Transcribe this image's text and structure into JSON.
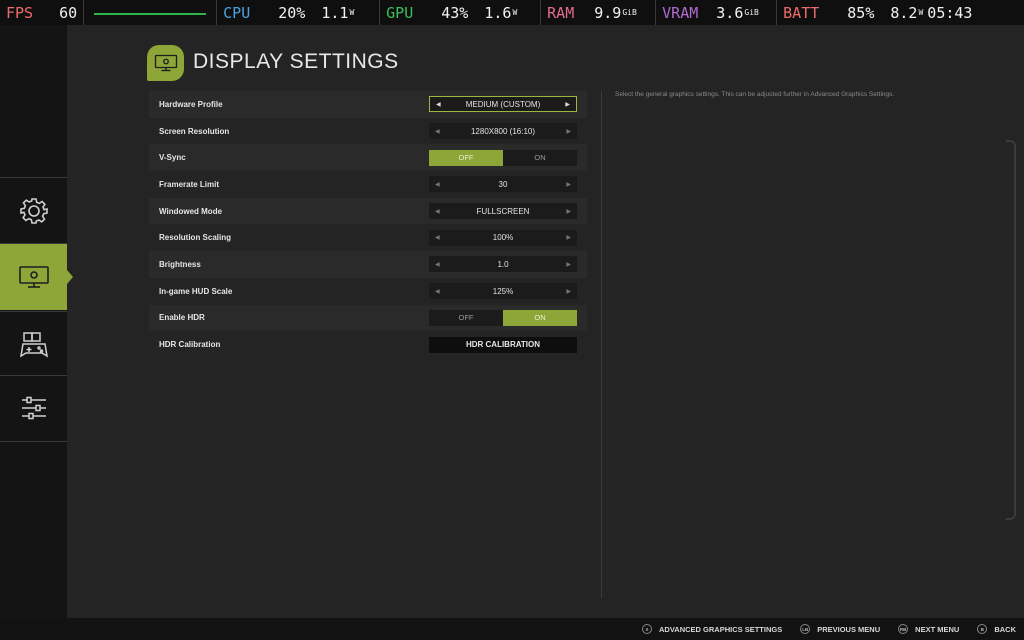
{
  "overlay": {
    "fps": {
      "label": "FPS",
      "value": "60",
      "color": "#ef6b6b"
    },
    "cpu": {
      "label": "CPU",
      "value": "20%",
      "power": "1.1",
      "unit": "W",
      "color": "#4aa3df"
    },
    "gpu": {
      "label": "GPU",
      "value": "43%",
      "power": "1.6",
      "unit": "W",
      "color": "#3fbf5a"
    },
    "ram": {
      "label": "RAM",
      "value": "9.9",
      "unit": "GiB",
      "color": "#e56b8e"
    },
    "vram": {
      "label": "VRAM",
      "value": "3.6",
      "unit": "GiB",
      "color": "#b36ad1"
    },
    "batt": {
      "label": "BATT",
      "value": "85%",
      "power": "8.2",
      "unit": "W",
      "color": "#ef6b6b"
    },
    "time": "05:43"
  },
  "rail": {
    "items": [
      {
        "icon": "gear-icon",
        "active": false
      },
      {
        "icon": "display-icon",
        "active": true
      },
      {
        "icon": "controller-icon",
        "active": false
      },
      {
        "icon": "sliders-icon",
        "active": false
      }
    ]
  },
  "header": {
    "title": "DISPLAY SETTINGS",
    "icon": "display-icon"
  },
  "settings": {
    "hardware_profile": {
      "label": "Hardware Profile",
      "value": "MEDIUM (CUSTOM)"
    },
    "screen_resolution": {
      "label": "Screen Resolution",
      "value": "1280X800 (16:10)"
    },
    "vsync": {
      "label": "V-Sync",
      "off": "OFF",
      "on": "ON",
      "selected": "OFF"
    },
    "framerate_limit": {
      "label": "Framerate Limit",
      "value": "30"
    },
    "windowed_mode": {
      "label": "Windowed Mode",
      "value": "FULLSCREEN"
    },
    "resolution_scaling": {
      "label": "Resolution Scaling",
      "value": "100%"
    },
    "brightness": {
      "label": "Brightness",
      "value": "1.0"
    },
    "hud_scale": {
      "label": "In-game HUD Scale",
      "value": "125%"
    },
    "hdr": {
      "label": "Enable HDR",
      "off": "OFF",
      "on": "ON",
      "selected": "ON"
    },
    "hdr_calibration": {
      "label": "HDR Calibration",
      "button": "HDR CALIBRATION"
    }
  },
  "description": "Select the general graphics settings. This can be adjusted further in Advanced Graphics Settings.",
  "footer": {
    "hints": [
      {
        "glyph": "X",
        "label": "ADVANCED GRAPHICS SETTINGS"
      },
      {
        "glyph": "LB",
        "label": "PREVIOUS MENU"
      },
      {
        "glyph": "RB",
        "label": "NEXT MENU"
      },
      {
        "glyph": "B",
        "label": "BACK"
      }
    ]
  },
  "colors": {
    "accent": "#8da637",
    "background": "#242424",
    "rail": "#141414"
  }
}
